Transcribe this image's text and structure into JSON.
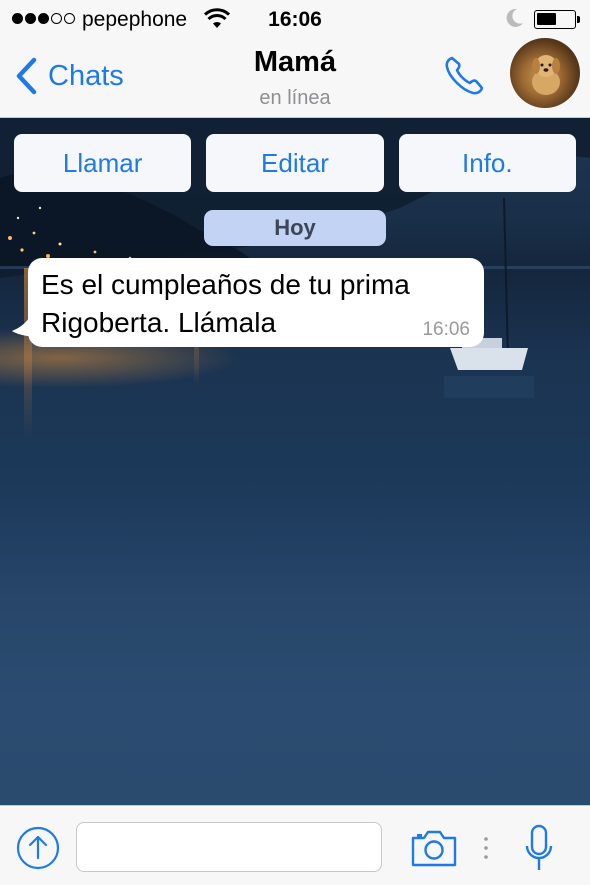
{
  "status_bar": {
    "carrier": "pepephone",
    "time": "16:06",
    "signal_full": 3,
    "signal_total": 5,
    "battery_level": 0.55,
    "icons": [
      "wifi-icon",
      "moon-icon",
      "battery-icon"
    ]
  },
  "nav": {
    "back_label": "Chats",
    "title": "Mamá",
    "subtitle": "en línea",
    "icons": [
      "chevron-left-icon",
      "phone-icon",
      "avatar"
    ]
  },
  "actions": {
    "call_label": "Llamar",
    "edit_label": "Editar",
    "info_label": "Info."
  },
  "chat": {
    "date_label": "Hoy",
    "messages": [
      {
        "text": "Es el cumpleaños de tu prima Rigoberta. Llámala",
        "time": "16:06",
        "direction": "incoming"
      }
    ]
  },
  "input_bar": {
    "placeholder": "",
    "value": "",
    "icons": [
      "share-icon",
      "camera-icon",
      "microphone-icon"
    ]
  },
  "colors": {
    "accent": "#1f7ae8",
    "bar_background": "#f7f7f7",
    "date_pill": "#c3d3f3",
    "secondary_text": "#8e8e93"
  }
}
